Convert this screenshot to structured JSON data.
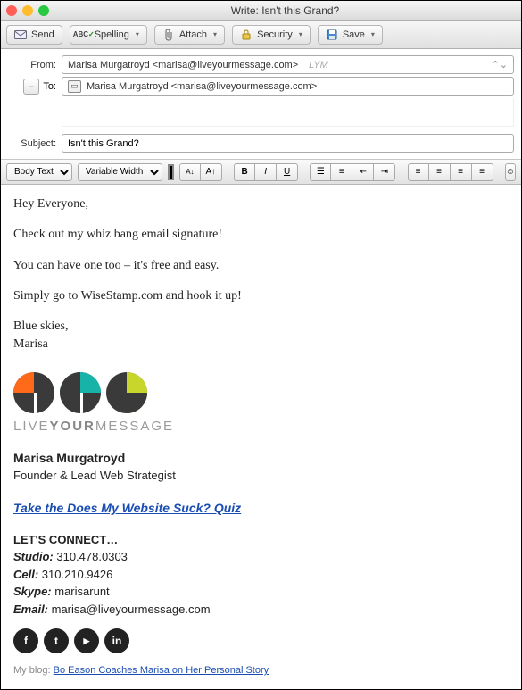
{
  "window": {
    "title": "Write: Isn't this Grand?"
  },
  "toolbar": {
    "send": "Send",
    "spelling": "Spelling",
    "attach": "Attach",
    "security": "Security",
    "save": "Save"
  },
  "headers": {
    "from_label": "From:",
    "from_value": "Marisa Murgatroyd <marisa@liveyourmessage.com>",
    "from_account": "LYM",
    "to_label": "To:",
    "to_value": "Marisa Murgatroyd <marisa@liveyourmessage.com>",
    "subject_label": "Subject:",
    "subject_value": "Isn't this Grand?"
  },
  "format": {
    "para_style": "Body Text",
    "font_family": "Variable Width"
  },
  "body": {
    "greeting": "Hey Everyone,",
    "l1": "Check out my whiz bang email signature!",
    "l2": "You can have one too – it's free and easy.",
    "l3a": "Simply go to ",
    "l3_link": "WiseStamp",
    "l3b": ".com and hook it up!",
    "sign1": "Blue skies,",
    "sign2": "Marisa"
  },
  "signature": {
    "brand_a": "LIVE",
    "brand_b": "YOUR",
    "brand_c": "MESSAGE",
    "name": "Marisa Murgatroyd",
    "role": "Founder & Lead Web Strategist",
    "quiz": "Take the Does My Website Suck? Quiz",
    "connect_hdr": "LET'S CONNECT…",
    "studio_l": "Studio:",
    "studio_v": " 310.478.0303",
    "cell_l": "Cell:",
    "cell_v": " 310.210.9426",
    "skype_l": "Skype:",
    "skype_v": " marisarunt",
    "email_l": "Email:",
    "email_v": " marisa@liveyourmessage.com",
    "blog_pre": "My blog: ",
    "blog_link": "Bo Eason Coaches Marisa on Her Personal Story"
  },
  "social": {
    "facebook": "f",
    "twitter": "t",
    "youtube": "▶",
    "linkedin": "in"
  }
}
